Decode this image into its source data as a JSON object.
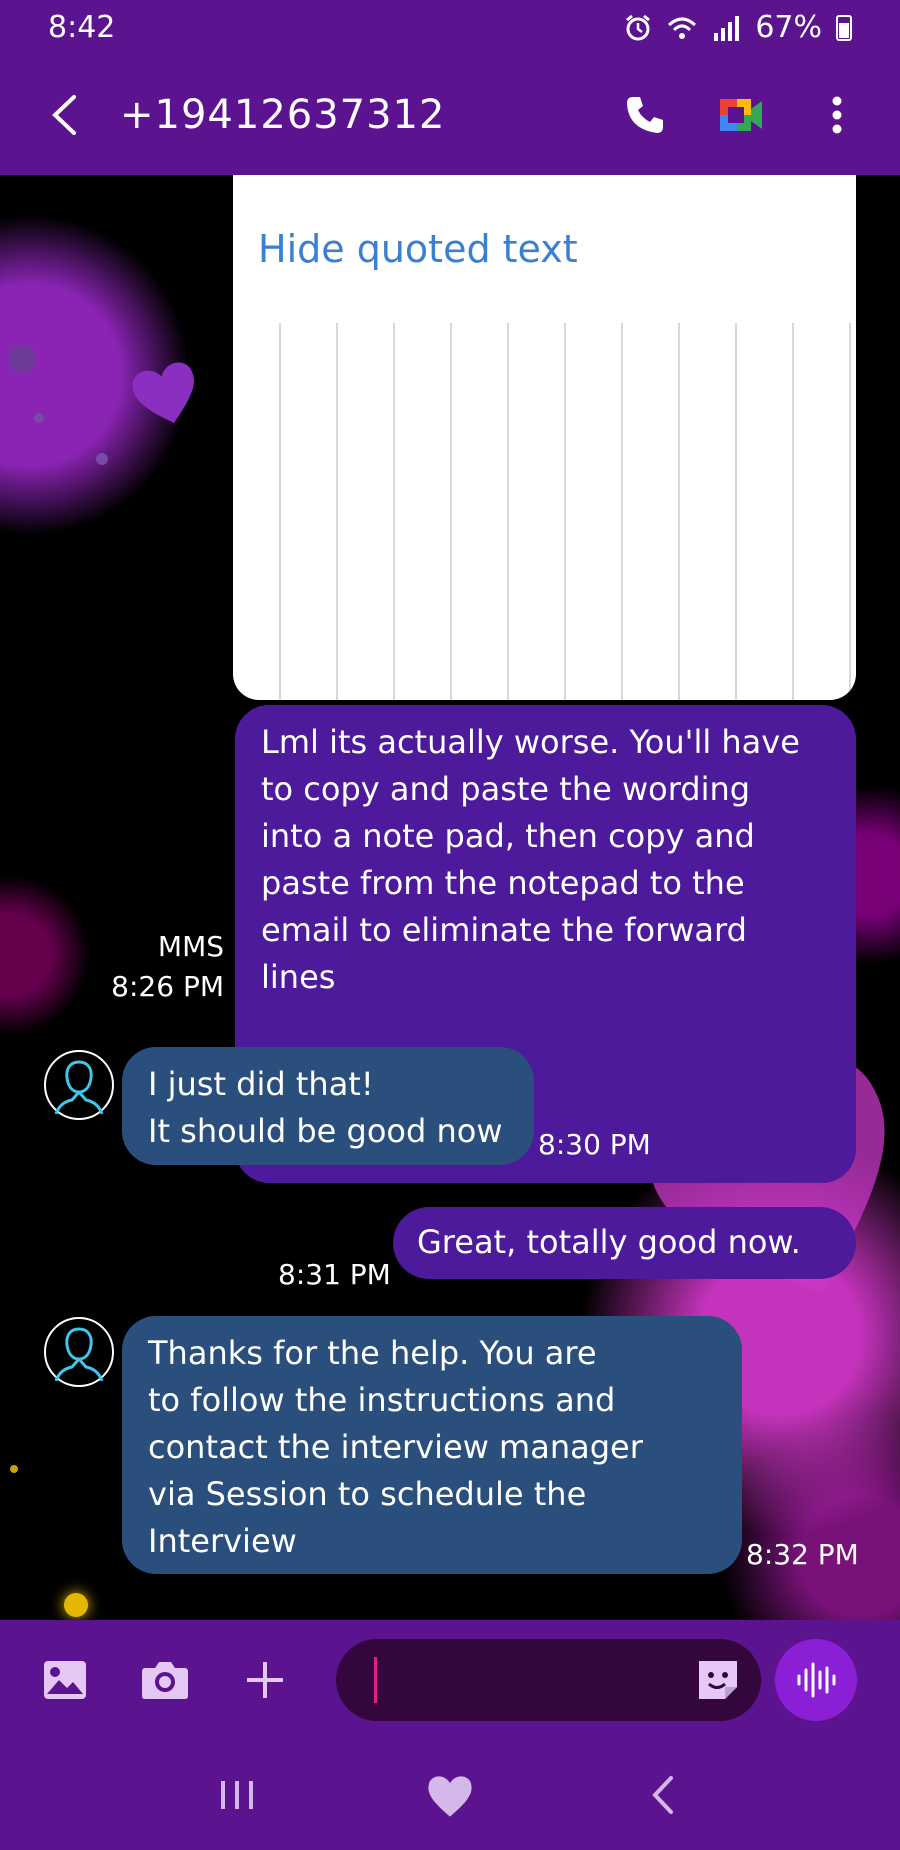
{
  "status_bar": {
    "time": "8:42",
    "battery": "67%"
  },
  "header": {
    "contact": "+19412637312"
  },
  "quoted": {
    "link_label": "Hide quoted text"
  },
  "messages": [
    {
      "direction": "outgoing",
      "text": "Lml its actually worse. You'll have\nto copy and paste the wording\ninto a note pad, then copy and\npaste from the notepad to the\nemail to eliminate the forward\nlines",
      "type": "MMS",
      "time": "8:26 PM"
    },
    {
      "direction": "incoming",
      "text": "I just did that!\nIt should be good now",
      "time": "8:30 PM"
    },
    {
      "direction": "outgoing",
      "text": "Great, totally good now.",
      "time": "8:31 PM"
    },
    {
      "direction": "incoming",
      "text": "Thanks for the help. You are\nto follow the instructions and\ncontact the interview manager\nvia Session to schedule the\nInterview",
      "time": "8:32 PM"
    }
  ],
  "composer": {
    "placeholder": ""
  },
  "colors": {
    "appbar": "#5c138f",
    "outgoing_bubble": "#4c1a9a",
    "incoming_bubble": "#2a4f7c",
    "link": "#3a7fd1"
  },
  "icons": [
    "alarm-icon",
    "wifi-icon",
    "signal-icon",
    "battery-icon",
    "back-arrow-icon",
    "phone-icon",
    "video-call-icon",
    "more-options-icon",
    "contact-avatar-icon",
    "gallery-icon",
    "camera-icon",
    "plus-icon",
    "sticker-icon",
    "voice-icon",
    "recent-apps-icon",
    "home-heart-icon",
    "nav-back-icon"
  ]
}
